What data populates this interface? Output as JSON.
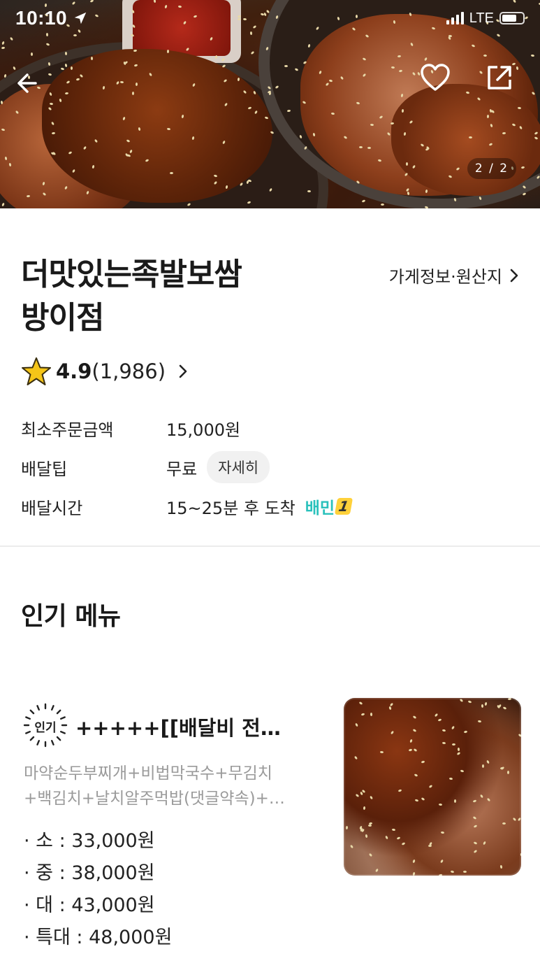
{
  "status_bar": {
    "time": "10:10",
    "network": "LTE"
  },
  "hero": {
    "image_counter": "2 / 2",
    "icons": [
      "back-arrow-icon",
      "heart-icon",
      "share-icon"
    ]
  },
  "store": {
    "name_line1": "더맛있는족발보쌈",
    "name_line2": "방이점",
    "info_link_label": "가게정보·원산지",
    "rating": "4.9",
    "review_count": "(1,986)"
  },
  "info": {
    "min_order_label": "최소주문금액",
    "min_order_value": "15,000원",
    "delivery_tip_label": "배달팁",
    "delivery_tip_value": "무료",
    "detail_button": "자세히",
    "delivery_time_label": "배달시간",
    "delivery_time_value": "15~25분 후 도착",
    "badge_text": "배민",
    "badge_number": "1"
  },
  "popular": {
    "section_title": "인기 메뉴",
    "badge_text": "인기",
    "item": {
      "name": "+++++[[배달비 전…",
      "desc_line1": "마약순두부찌개+비법막국수+무김치",
      "desc_line2": "+백김치+날치알주먹밥(댓글약속)+…",
      "prices": [
        "· 소 : 33,000원",
        "· 중 : 38,000원",
        "· 대 : 43,000원",
        "· 특대 : 48,000원"
      ]
    }
  },
  "colors": {
    "baemin_mint": "#2ac1bc",
    "badge_yellow": "#ffd13a",
    "star_gold": "#f5c518"
  }
}
